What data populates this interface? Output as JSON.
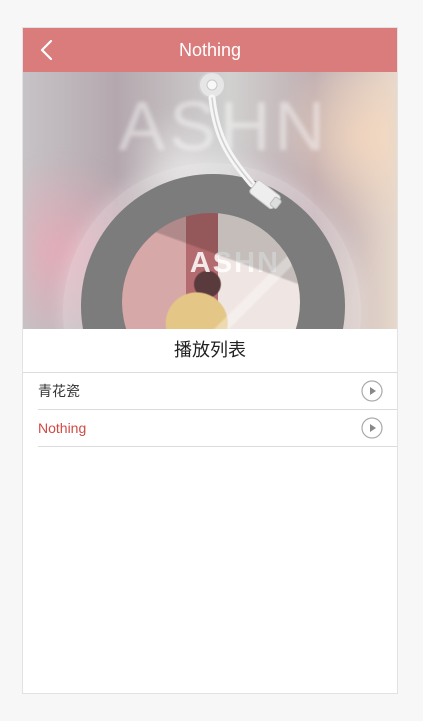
{
  "header": {
    "title": "Nothing",
    "background": "#db7c7c",
    "icons": {
      "back": "chevron-left-icon"
    }
  },
  "hero": {
    "watermark": "ASHN",
    "cover_text": "ASHN"
  },
  "playlist": {
    "title": "播放列表",
    "items": [
      {
        "name": "青花瓷",
        "active": false,
        "icon": "play-icon"
      },
      {
        "name": "Nothing",
        "active": true,
        "icon": "play-icon"
      }
    ],
    "active_color": "#d14a44"
  }
}
